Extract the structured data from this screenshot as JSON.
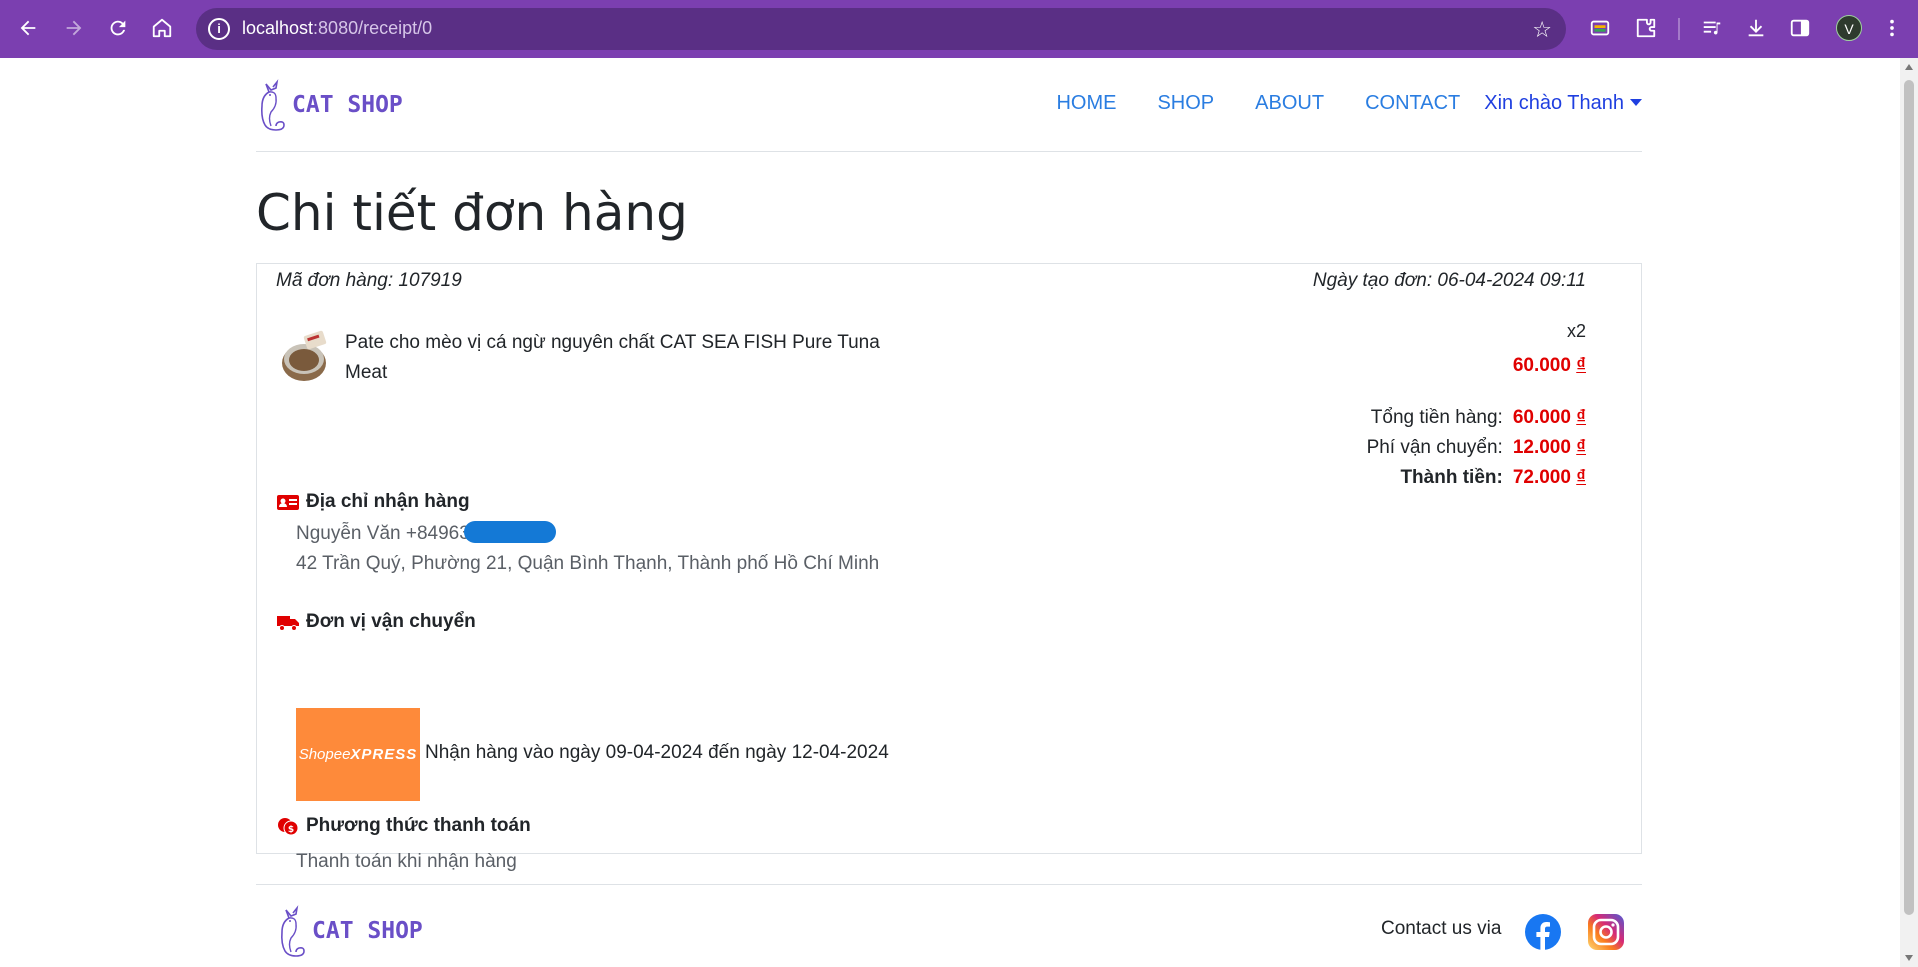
{
  "browser": {
    "url_host": "localhost",
    "url_rest": ":8080/receipt/0",
    "profile_initial": "V"
  },
  "navbar": {
    "logo_text": "CAT SHOP",
    "links": [
      "HOME",
      "SHOP",
      "ABOUT",
      "CONTACT"
    ],
    "user_greeting": "Xin chào Thanh"
  },
  "page": {
    "title": "Chi tiết đơn hàng"
  },
  "order": {
    "id_label": "Mã đơn hàng: 107919",
    "date_label": "Ngày tạo đơn: 06-04-2024 09:11",
    "item": {
      "name": "Pate cho mèo vị cá ngừ nguyên chất CAT SEA FISH Pure Tuna Meat",
      "quantity": "x2",
      "price": "60.000",
      "currency": "₫"
    },
    "totals": [
      {
        "label": "Tổng tiền hàng:",
        "value": "60.000",
        "currency": "₫"
      },
      {
        "label": "Phí vận chuyển:",
        "value": "12.000",
        "currency": "₫"
      },
      {
        "label": "Thành tiền:",
        "value": "72.000",
        "currency": "₫"
      }
    ]
  },
  "address": {
    "heading": "Địa chỉ nhận hàng",
    "name_phone": "Nguyễn Văn +84963",
    "street": "42 Trần Quý, Phường 21, Quận Bình Thạnh, Thành phố Hồ Chí Minh"
  },
  "shipping": {
    "heading": "Đơn vị vận chuyển",
    "carrier_logo_text_a": "Shopee",
    "carrier_logo_text_b": "XPRESS",
    "delivery_text": "Nhận hàng vào ngày 09-04-2024 đến ngày 12-04-2024"
  },
  "payment": {
    "heading": "Phương thức thanh toán",
    "method": "Thanh toán khi nhận hàng"
  },
  "footer": {
    "logo_text": "CAT SHOP",
    "contact_label": "Contact us via"
  },
  "colors": {
    "browser_frame": "#7b3fb0",
    "nav_link": "#2a7de1",
    "price_red": "#e00000",
    "shipping_orange": "#fe8a3a",
    "logo_purple": "#6a4fc7"
  }
}
